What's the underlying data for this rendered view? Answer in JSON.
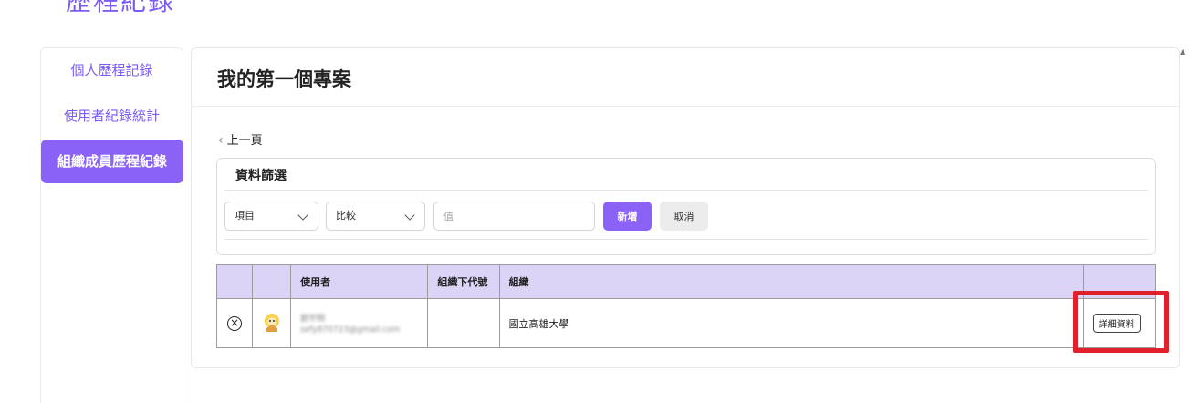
{
  "page": {
    "title": "歷程紀錄"
  },
  "sidebar": {
    "items": [
      {
        "label": "個人歷程記錄",
        "active": false
      },
      {
        "label": "使用者紀錄統計",
        "active": false
      },
      {
        "label": "組織成員歷程紀錄",
        "active": true
      }
    ]
  },
  "main": {
    "title": "我的第一個專案",
    "back_label": "上一頁",
    "filter": {
      "title": "資料篩選",
      "item_select": "項目",
      "compare_select": "比較",
      "value_placeholder": "值",
      "add_label": "新增",
      "cancel_label": "取消"
    },
    "table": {
      "columns": [
        "",
        "",
        "使用者",
        "組織下代號",
        "組織",
        ""
      ],
      "rows": [
        {
          "user_name": "劉宇翔",
          "user_email": "sefy870723@gmail.com",
          "org_code": "",
          "org": "國立高雄大學",
          "detail_label": "詳細資料"
        }
      ]
    }
  },
  "colors": {
    "accent": "#8a63f6",
    "highlight": "#e0202a",
    "header_bg": "#dcd4f6"
  }
}
